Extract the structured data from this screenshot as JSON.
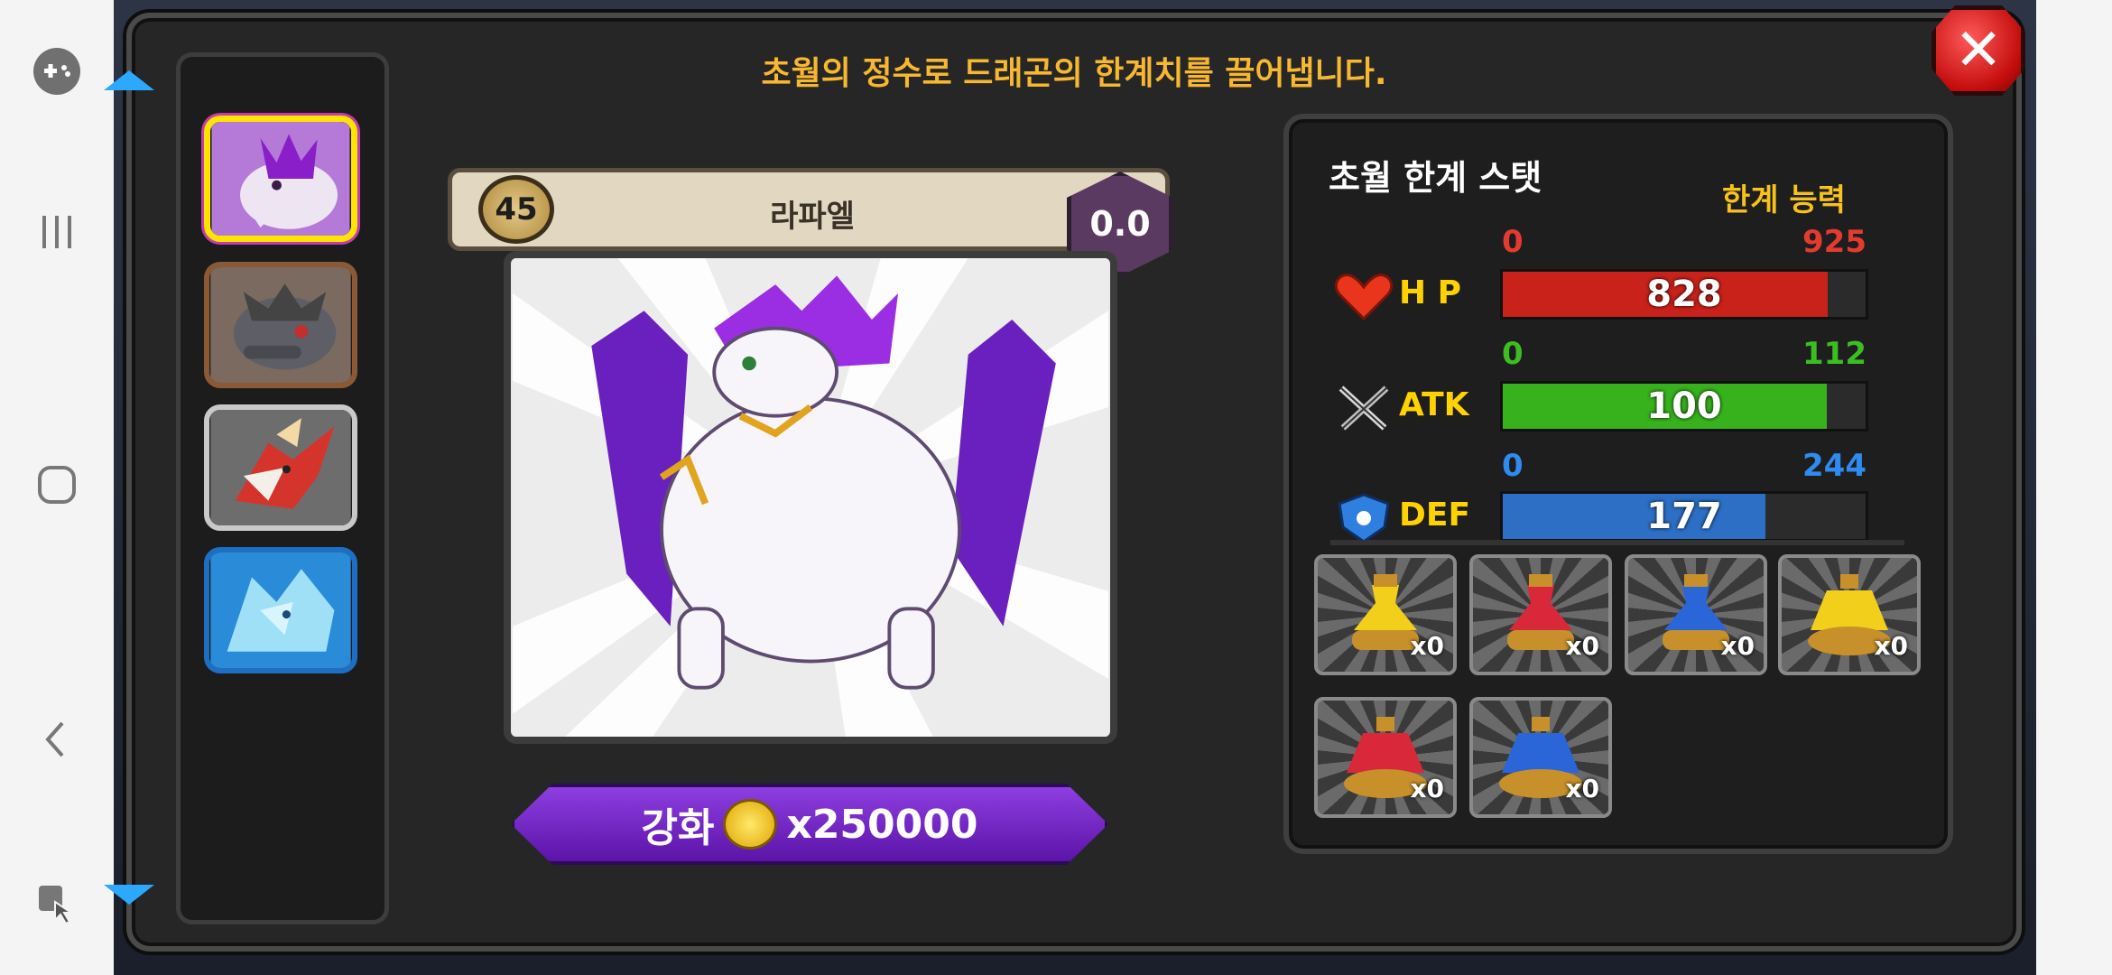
{
  "title": "초월의 정수로 드래곤의 한계치를 끌어냅니다.",
  "close_icon": "close-icon",
  "dragon": {
    "level": "45",
    "name": "라파엘",
    "grade": "0.0"
  },
  "enhance": {
    "label": "강화",
    "cost": "x250000",
    "coin_icon": "gold-coin-icon"
  },
  "stats_panel": {
    "title": "초월 한계 스탯",
    "limit_label": "한계 능력",
    "stats": [
      {
        "name": "H P",
        "icon": "heart-icon",
        "min": "0",
        "max": "925",
        "value": "828",
        "fill": 0.895,
        "color": "#c9221a",
        "minmax_color": "#e53a2f"
      },
      {
        "name": "ATK",
        "icon": "crossed-swords-icon",
        "min": "0",
        "max": "112",
        "value": "100",
        "fill": 0.893,
        "color": "#37b21d",
        "minmax_color": "#3cbd22"
      },
      {
        "name": "DEF",
        "icon": "shield-icon",
        "min": "0",
        "max": "244",
        "value": "177",
        "fill": 0.725,
        "color": "#2c6fc4",
        "minmax_color": "#2e8bf0"
      }
    ]
  },
  "potions": [
    {
      "icon": "yellow-potion-icon",
      "count": "x0",
      "color": "#f1cf1a"
    },
    {
      "icon": "red-potion-icon",
      "count": "x0",
      "color": "#d8283a"
    },
    {
      "icon": "blue-potion-icon",
      "count": "x0",
      "color": "#2a66d8"
    },
    {
      "icon": "large-yellow-potion-icon",
      "count": "x0",
      "color": "#f1cf1a"
    },
    {
      "icon": "large-red-potion-icon",
      "count": "x0",
      "color": "#d8283a"
    },
    {
      "icon": "large-blue-potion-icon",
      "count": "x0",
      "color": "#2a66d8"
    }
  ],
  "dragon_list": [
    {
      "icon": "purple-dragon-thumbnail"
    },
    {
      "icon": "gray-dragon-thumbnail"
    },
    {
      "icon": "red-dragon-thumbnail"
    },
    {
      "icon": "ice-dragon-thumbnail"
    }
  ]
}
